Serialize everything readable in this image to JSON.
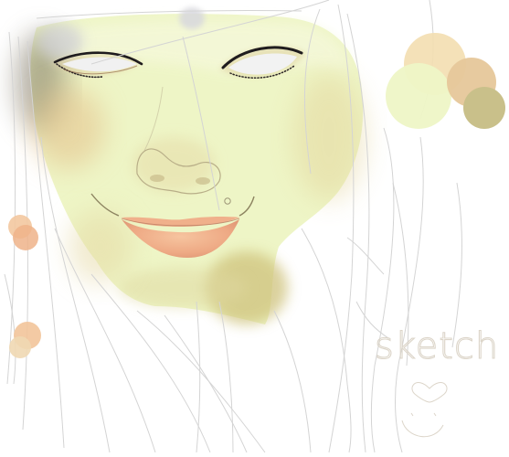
{
  "artwork": {
    "signature_text": "sketch",
    "has_heart_doodle": true,
    "has_smile_doodle": true
  },
  "palette": {
    "skin_base": "#eef5c6",
    "skin_shadow": "#d9cf8c",
    "skin_warm": "#e6c79a",
    "lips": "#f2b48e",
    "eye_white": "#f2f2f2",
    "lash": "#1f1c1e",
    "sketch_line": "#d6d6d6",
    "swatches": [
      "#f3deb0",
      "#e8d4a8",
      "#eef5c6",
      "#e6c79a",
      "#c9c08a",
      "#f0b88a",
      "#f3c8a0"
    ]
  }
}
